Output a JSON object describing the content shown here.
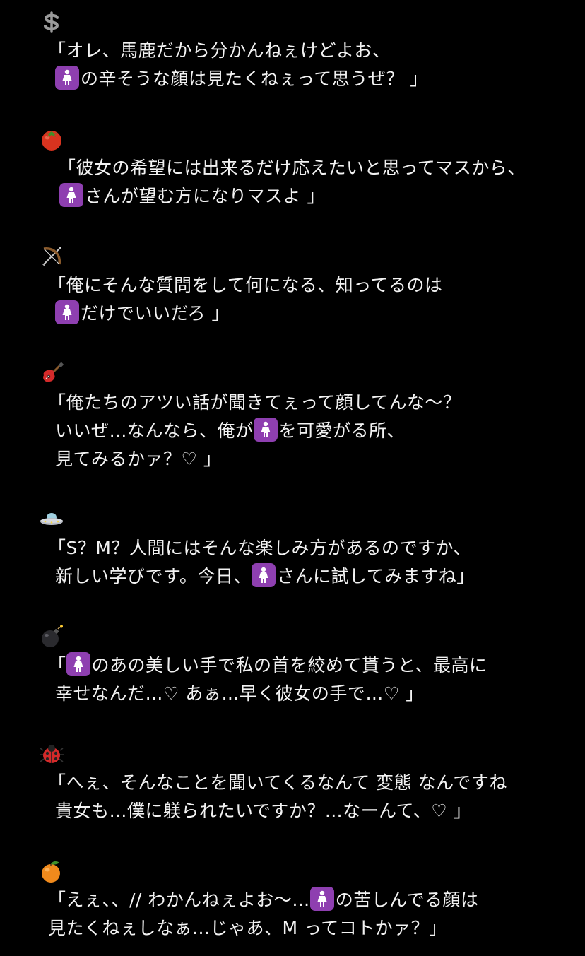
{
  "colors": {
    "background": "#000000",
    "text": "#f2f2f2",
    "badge": "#8e3fb0"
  },
  "entries": [
    {
      "icon": "dollar-sign-icon",
      "lines": [
        [
          "「オレ、馬鹿だから分かんねぇけどよお、"
        ],
        [
          "",
          "の辛そうな顔は見たくねぇって思うぜ？ 」"
        ]
      ]
    },
    {
      "icon": "tomato-icon",
      "lines": [
        [
          "「彼女の希望には出来るだけ応えたいと思ってマスから、"
        ],
        [
          "",
          "さんが望む方になりマスよ 」"
        ]
      ]
    },
    {
      "icon": "bow-and-arrow-icon",
      "lines": [
        [
          "「俺にそんな質問をして何になる、知ってるのは"
        ],
        [
          "",
          "だけでいいだろ 」"
        ]
      ]
    },
    {
      "icon": "guitar-icon",
      "lines": [
        [
          "「俺たちのアツい話が聞きてぇって顔してんな〜？"
        ],
        [
          "いいぜ…なんなら、俺が",
          "を可愛がる所、"
        ],
        [
          "見てみるかァ？♡ 」"
        ]
      ]
    },
    {
      "icon": "flying-saucer-icon",
      "lines": [
        [
          "「S？M？人間にはそんな楽しみ方があるのですか、"
        ],
        [
          "新しい学びです。今日、",
          "さんに試してみますね」"
        ]
      ]
    },
    {
      "icon": "bomb-icon",
      "lines": [
        [
          "「",
          "のあの美しい手で私の首を絞めて貰うと、最高に"
        ],
        [
          "幸せなんだ…♡ あぁ…早く彼女の手で…♡ 」"
        ]
      ]
    },
    {
      "icon": "lady-beetle-icon",
      "lines": [
        [
          "「へぇ、そんなことを聞いてくるなんて 変態 なんですね"
        ],
        [
          "貴女も…僕に躾られたいですか？…なーんて、♡ 」"
        ]
      ]
    },
    {
      "icon": "tangerine-icon",
      "lines": [
        [
          "「えぇ、、// わかんねぇよお〜…",
          "の苦しんでる顔は"
        ],
        [
          "見たくねぇしなぁ…じゃあ、M ってコトかァ？」"
        ]
      ]
    }
  ]
}
